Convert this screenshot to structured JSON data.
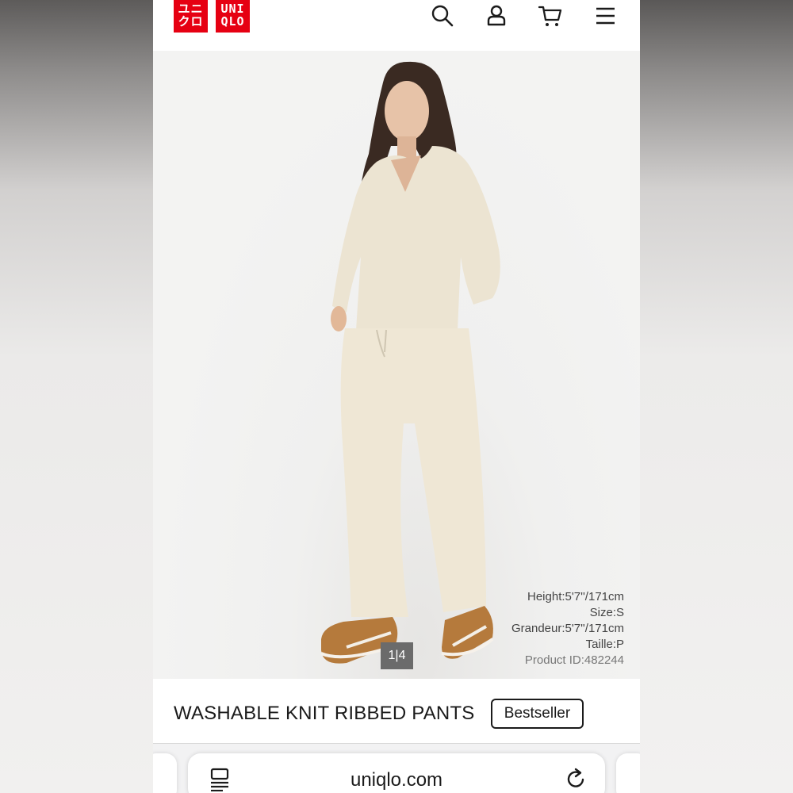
{
  "brand": {
    "logo_line1_left": "ユニ",
    "logo_line2_left": "クロ",
    "logo_line1_right": "UNI",
    "logo_line2_right": "QLO",
    "color": "#e60012"
  },
  "header_icons": [
    "search-icon",
    "account-icon",
    "cart-icon",
    "menu-icon"
  ],
  "gallery": {
    "counter": "1|4"
  },
  "model_info": {
    "height": "Height:5'7''/171cm",
    "size": "Size:S",
    "grandeur": "Grandeur:5'7''/171cm",
    "taille": "Taille:P",
    "product_id": "Product ID:482244"
  },
  "product": {
    "title": "WASHABLE KNIT RIBBED PANTS",
    "badge": "Bestseller"
  },
  "browser": {
    "url": "uniqlo.com"
  }
}
